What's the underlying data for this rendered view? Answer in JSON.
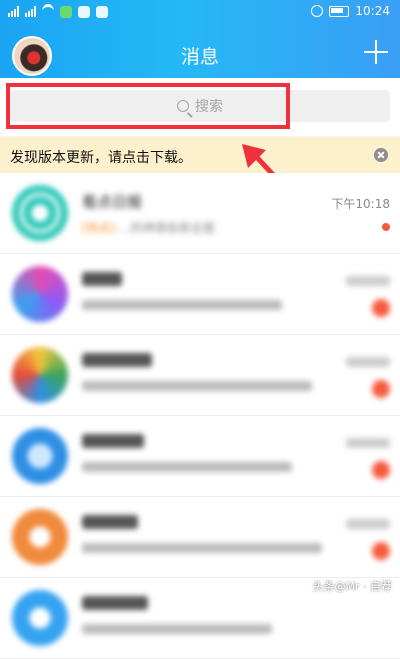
{
  "status_bar": {
    "left_text": "",
    "time": "10:24"
  },
  "header": {
    "title": "消息",
    "add_icon": "plus-icon",
    "avatar": "user-avatar"
  },
  "search": {
    "placeholder": "搜索",
    "icon": "search-icon"
  },
  "banner": {
    "text": "发现版本更新，请点击下载。",
    "close_icon": "close-circle-icon"
  },
  "conversations": [
    {
      "name": "看点日报",
      "tag": "[热点]",
      "preview": "  ...的神德各款全面",
      "time": "下午10:18",
      "indicator": "dot",
      "avatar_color": "#2cc7b8"
    },
    {
      "name": "",
      "tag": "",
      "preview": "",
      "time": "",
      "indicator": "badge",
      "avatar_color": "#8b5cf6"
    },
    {
      "name": "",
      "tag": "",
      "preview": "",
      "time": "",
      "indicator": "badge",
      "avatar_color": "#3aa55c"
    },
    {
      "name": "",
      "tag": "",
      "preview": "",
      "time": "",
      "indicator": "badge",
      "avatar_color": "#2f8fe6"
    },
    {
      "name": "",
      "tag": "",
      "preview": "",
      "time": "",
      "indicator": "badge",
      "avatar_color": "#f08a3c"
    },
    {
      "name": "",
      "tag": "",
      "preview": "",
      "time": "",
      "indicator": "badge",
      "avatar_color": "#35a3f0"
    }
  ],
  "watermark": "头条@Mr · 自荐",
  "colors": {
    "header_blue": "#25b8f6",
    "highlight_red": "#f0313b",
    "banner_bg": "#fdf0cc",
    "badge_red": "#f55a3c"
  }
}
